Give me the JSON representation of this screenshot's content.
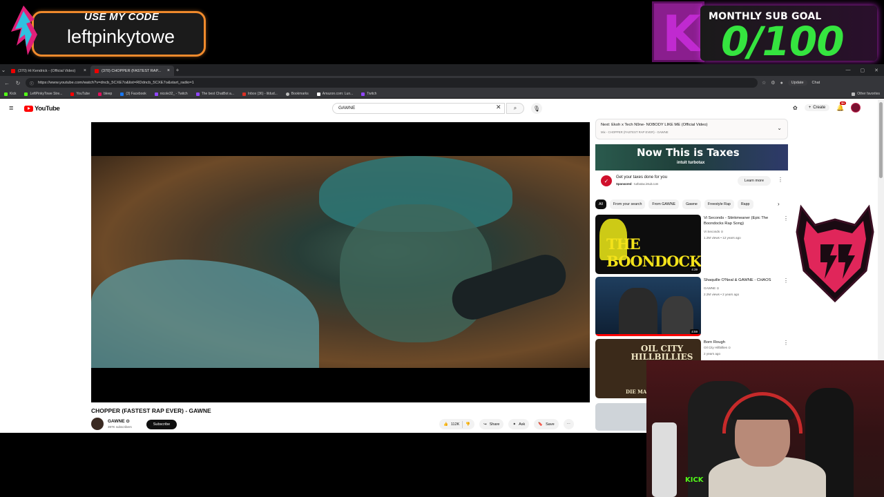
{
  "overlay": {
    "code_title": "USE MY CODE",
    "code_value": "leftpinkytowe",
    "subgoal_label": "MONTHLY SUB GOAL",
    "subgoal_value": "0/100",
    "webcam_brand": "KICK"
  },
  "browser": {
    "tabs": [
      {
        "label": "(370) Hi Kendrick - (Official Video)",
        "active": false
      },
      {
        "label": "(370) CHOPPER (FASTEST RAP...",
        "active": true
      }
    ],
    "url": "https://www.youtube.com/watch?v=dncb_5CXE7o&list=RDdncb_5CXE7o&start_radio=1",
    "update_label": "Update",
    "chat_label": "Chat",
    "bookmarks": [
      {
        "label": "Kick",
        "color": "#53fc18"
      },
      {
        "label": "LeftPinkyTowe Stre...",
        "color": "#53fc18"
      },
      {
        "label": "YouTube",
        "color": "#ff0000"
      },
      {
        "label": "bleep",
        "color": "#e0105a"
      },
      {
        "label": "(3) Facebook",
        "color": "#1877f2"
      },
      {
        "label": "nicole32_ - Twitch",
        "color": "#9146ff"
      },
      {
        "label": "The best ChatBot a...",
        "color": "#9146ff"
      },
      {
        "label": "Inbox (36) - lildud...",
        "color": "#d93025"
      },
      {
        "label": "Bookmarks",
        "color": "#bbbbbb"
      },
      {
        "label": "Amazon.com: Lun...",
        "color": "#ffffff"
      },
      {
        "label": "Twitch",
        "color": "#9146ff"
      }
    ],
    "other_favorites": "Other favorites"
  },
  "youtube": {
    "logo_text": "YouTube",
    "search_query": "GAWNE",
    "create_label": "Create",
    "notif_count": "9+",
    "video_title": "CHOPPER (FASTEST RAP EVER) - GAWNE",
    "channel_name": "GAWNE",
    "channel_subs": "397K subscribers",
    "subscribe_label": "Subscribe",
    "like_count": "112K",
    "share_label": "Share",
    "ask_label": "Ask",
    "save_label": "Save",
    "next_title": "Next: Ekoh x Tech N9ne- NOBODY LIKE ME (Official Video)",
    "next_sub": "Mix - CHOPPER (FASTEST RAP EVER) - GAWNE",
    "ad_headline": "Now This is Taxes",
    "ad_brand": "intuit turbotax",
    "ad_text": "Get your taxes done for you",
    "ad_sponsored": "Sponsored",
    "ad_domain": "turbotax.intuit.com",
    "learn_more": "Learn more",
    "chips": [
      "All",
      "From your search",
      "From GAWNE",
      "Gawne",
      "Freestyle Rap",
      "Rapp"
    ],
    "recommendations": [
      {
        "title": "Vi Seconds - Stinkmeaner (Epic The Boondocks Rap Song)",
        "channel": "Vi Seconds",
        "meta": "1.2M views • 12 years ago",
        "duration": "4:39",
        "thumb_text": "THE BOONDOCKS"
      },
      {
        "title": "Shaquille O'Neal & GAWNE - CHAOS",
        "channel": "GAWNE",
        "meta": "2.2M views • 2 years ago",
        "duration": "4:59",
        "thumb_text": ""
      },
      {
        "title": "Born Rough",
        "channel": "Oil City Hillbillies",
        "meta": "2 years ago",
        "duration": "",
        "thumb_text": "OIL CITY HILLBILLIES",
        "thumb_sub": "DIE MAD"
      }
    ]
  }
}
